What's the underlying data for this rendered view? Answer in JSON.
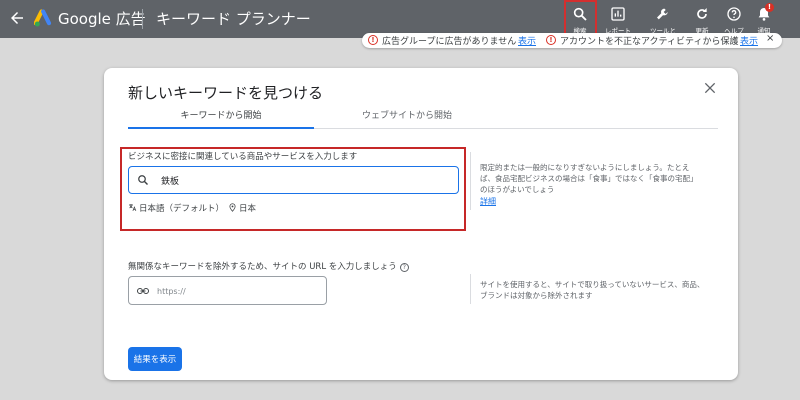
{
  "header": {
    "brand": "Google 広告",
    "title": "キーワード プランナー",
    "tools": [
      {
        "label": "検索",
        "icon": "search-icon"
      },
      {
        "label": "レポート",
        "icon": "report-icon"
      },
      {
        "label": "ツールと",
        "icon": "wrench-icon"
      },
      {
        "label": "更新",
        "icon": "refresh-icon"
      },
      {
        "label": "ヘルプ",
        "icon": "help-icon"
      },
      {
        "label": "通知",
        "icon": "bell-icon"
      }
    ],
    "notify_badge": "!"
  },
  "alerts": [
    {
      "text": "広告グループに広告がありません",
      "link": "表示"
    },
    {
      "text": "アカウントを不正なアクティビティから保護",
      "link": "表示"
    }
  ],
  "alert_close": "×",
  "dialog": {
    "title": "新しいキーワードを見つける",
    "close": "×",
    "tabs": [
      {
        "label": "キーワードから開始",
        "active": true
      },
      {
        "label": "ウェブサイトから開始",
        "active": false
      }
    ],
    "keyword_prompt": "ビジネスに密接に関連している商品やサービスを入力します",
    "keyword_value": "鉄板",
    "language": "日本語（デフォルト）",
    "location": "日本",
    "hint": "限定的または一般的になりすぎないようにしましょう。たとえば、食品宅配ビジネスの場合は「食事」ではなく「食事の宅配」のほうがよいでしょう",
    "details_link": "詳細",
    "url_label": "無関係なキーワードを除外するため、サイトの URL を入力しましょう",
    "url_help": "?",
    "url_placeholder": "https://",
    "url_hint": "サイトを使用すると、サイトで取り扱っていないサービス、商品、ブランドは対象から除外されます",
    "submit": "結果を表示"
  },
  "colors": {
    "topbar": "#5f6368",
    "accent": "#1a73e8",
    "highlight": "#c62828"
  }
}
